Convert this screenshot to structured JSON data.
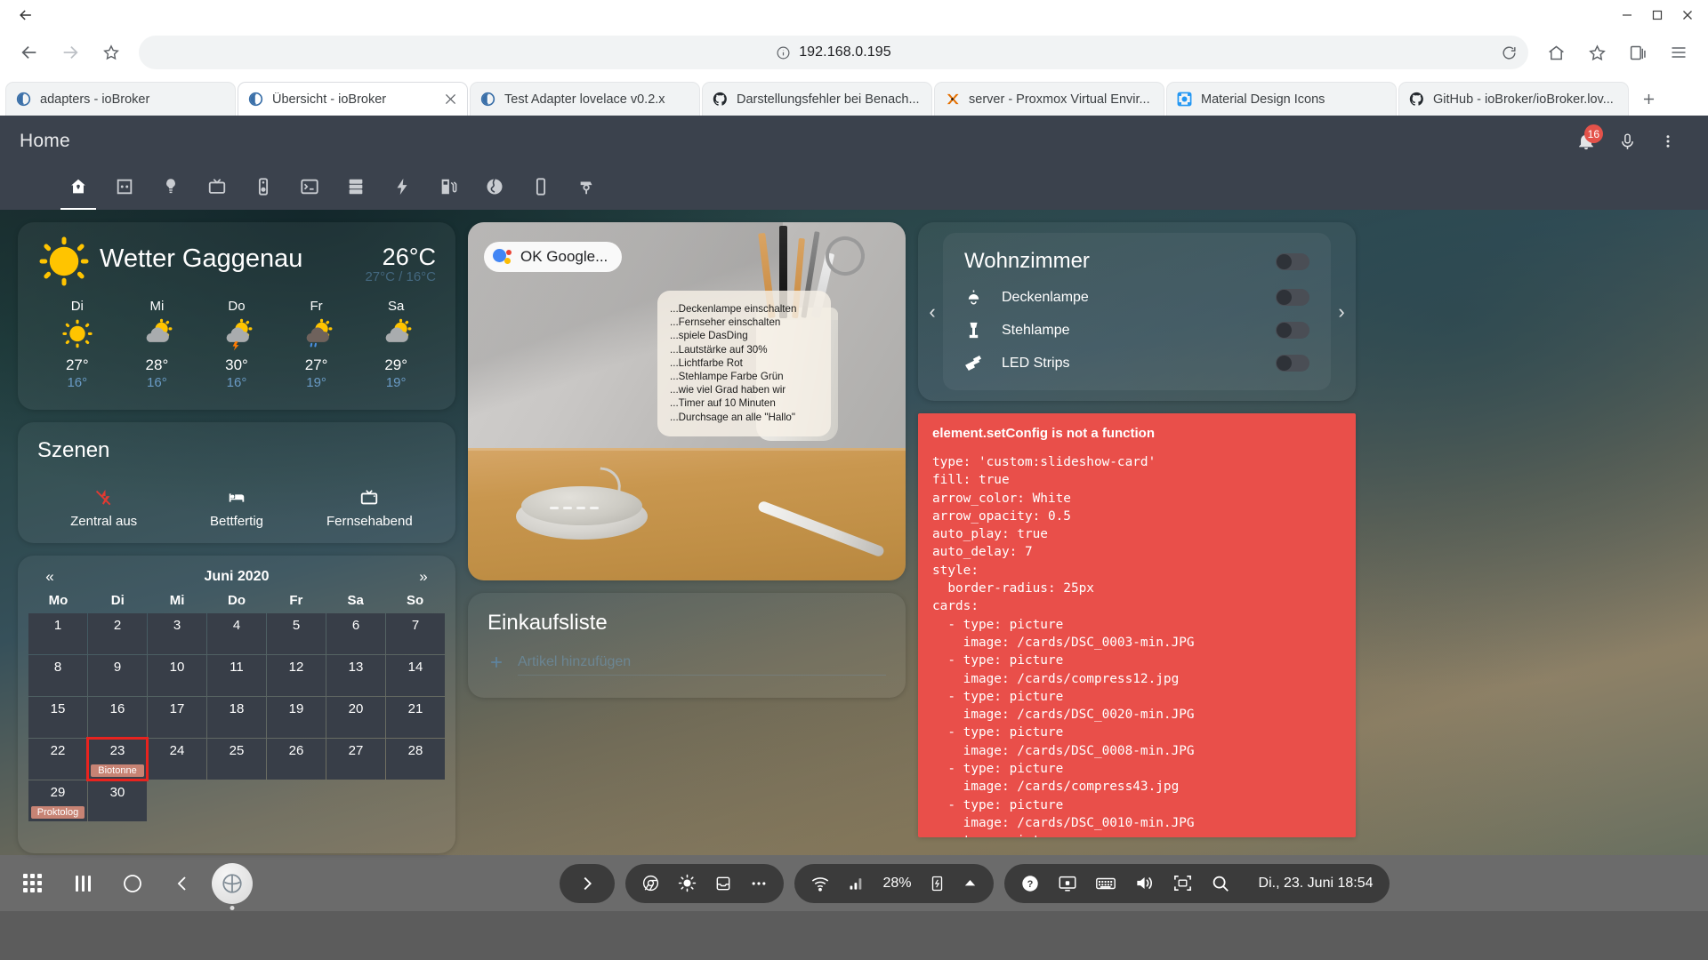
{
  "browser": {
    "url": "192.168.0.195",
    "tabs": [
      {
        "title": "adapters - ioBroker",
        "favicon": "iobroker-icon",
        "active": false,
        "closable": false
      },
      {
        "title": "Übersicht - ioBroker",
        "favicon": "iobroker-icon",
        "active": true,
        "closable": true
      },
      {
        "title": "Test Adapter lovelace v0.2.x",
        "favicon": "iobroker-icon",
        "active": false,
        "closable": false
      },
      {
        "title": "Darstellungsfehler bei Benach...",
        "favicon": "github-icon",
        "active": false,
        "closable": false
      },
      {
        "title": "server - Proxmox Virtual Envir...",
        "favicon": "proxmox-icon",
        "active": false,
        "closable": false
      },
      {
        "title": "Material Design Icons",
        "favicon": "mdi-icon",
        "active": false,
        "closable": false
      },
      {
        "title": "GitHub - ioBroker/ioBroker.lov...",
        "favicon": "github-icon",
        "active": false,
        "closable": false
      }
    ],
    "new_tab_label": "+",
    "window_controls": {
      "minimize": "–",
      "maximize": "□",
      "close": "✕"
    }
  },
  "app": {
    "title": "Home",
    "notification_count": "16",
    "tabs": [
      {
        "icon": "home-icon",
        "selected": true
      },
      {
        "icon": "power-socket-icon",
        "selected": false
      },
      {
        "icon": "lightbulb-icon",
        "selected": false
      },
      {
        "icon": "television-icon",
        "selected": false
      },
      {
        "icon": "speaker-icon",
        "selected": false
      },
      {
        "icon": "console-icon",
        "selected": false
      },
      {
        "icon": "server-icon",
        "selected": false
      },
      {
        "icon": "flash-icon",
        "selected": false
      },
      {
        "icon": "fuel-icon",
        "selected": false
      },
      {
        "icon": "earth-icon",
        "selected": false
      },
      {
        "icon": "cellphone-icon",
        "selected": false
      },
      {
        "icon": "cctv-icon",
        "selected": false
      }
    ]
  },
  "weather": {
    "name": "Wetter Gaggenau",
    "current_temp": "26°C",
    "sub_temp": "27°C / 16°C",
    "current_icon": "sunny-icon",
    "forecast": [
      {
        "day": "Di",
        "icon": "sunny-icon",
        "high": "27°",
        "low": "16°"
      },
      {
        "day": "Mi",
        "icon": "partly-cloudy-icon",
        "high": "28°",
        "low": "16°"
      },
      {
        "day": "Do",
        "icon": "thunderstorm-icon",
        "high": "30°",
        "low": "16°"
      },
      {
        "day": "Fr",
        "icon": "rainy-icon",
        "high": "27°",
        "low": "19°"
      },
      {
        "day": "Sa",
        "icon": "partly-cloudy-icon",
        "high": "29°",
        "low": "19°"
      }
    ]
  },
  "scenes": {
    "title": "Szenen",
    "items": [
      {
        "label": "Zentral aus",
        "icon": "flash-off-icon",
        "color": "#e23a32"
      },
      {
        "label": "Bettfertig",
        "icon": "bed-icon",
        "color": "#ffffff"
      },
      {
        "label": "Fernsehabend",
        "icon": "television-icon",
        "color": "#ffffff"
      }
    ]
  },
  "calendar": {
    "month": "Juni 2020",
    "prev": "«",
    "next": "»",
    "weekdays": [
      "Mo",
      "Di",
      "Mi",
      "Do",
      "Fr",
      "Sa",
      "So"
    ],
    "days": [
      {
        "n": "1"
      },
      {
        "n": "2"
      },
      {
        "n": "3"
      },
      {
        "n": "4"
      },
      {
        "n": "5"
      },
      {
        "n": "6"
      },
      {
        "n": "7"
      },
      {
        "n": "8"
      },
      {
        "n": "9"
      },
      {
        "n": "10"
      },
      {
        "n": "11"
      },
      {
        "n": "12"
      },
      {
        "n": "13"
      },
      {
        "n": "14"
      },
      {
        "n": "15"
      },
      {
        "n": "16"
      },
      {
        "n": "17"
      },
      {
        "n": "18"
      },
      {
        "n": "19"
      },
      {
        "n": "20"
      },
      {
        "n": "21"
      },
      {
        "n": "22"
      },
      {
        "n": "23",
        "today": true,
        "event": "Biotonne"
      },
      {
        "n": "24"
      },
      {
        "n": "25"
      },
      {
        "n": "26"
      },
      {
        "n": "27"
      },
      {
        "n": "28"
      },
      {
        "n": "29",
        "event": "Proktolog"
      },
      {
        "n": "30"
      }
    ]
  },
  "google_card": {
    "badge": "OK Google...",
    "commands": [
      "...Deckenlampe einschalten",
      "...Fernseher einschalten",
      "...spiele DasDing",
      "...Lautstärke auf 30%",
      "...Lichtfarbe Rot",
      "...Stehlampe Farbe Grün",
      "...wie viel Grad haben wir",
      "...Timer auf 10 Minuten",
      "...Durchsage an alle \"Hallo\""
    ]
  },
  "shopping": {
    "title": "Einkaufsliste",
    "input_value": "",
    "input_placeholder": "Artikel hinzufügen",
    "add_icon": "plus-icon"
  },
  "livingroom": {
    "title": "Wohnzimmer",
    "prev_arrow": "‹",
    "next_arrow": "›",
    "master_toggle": "off",
    "rows": [
      {
        "label": "Deckenlampe",
        "icon": "ceiling-light-icon",
        "state": "off"
      },
      {
        "label": "Stehlampe",
        "icon": "floor-lamp-icon",
        "state": "off"
      },
      {
        "label": "LED Strips",
        "icon": "led-strip-icon",
        "state": "off"
      }
    ]
  },
  "error_card": {
    "title": "element.setConfig is not a function",
    "background": "#e94f4a",
    "yaml": "type: 'custom:slideshow-card'\nfill: true\narrow_color: White\narrow_opacity: 0.5\nauto_play: true\nauto_delay: 7\nstyle:\n  border-radius: 25px\ncards:\n  - type: picture\n    image: /cards/DSC_0003-min.JPG\n  - type: picture\n    image: /cards/compress12.jpg\n  - type: picture\n    image: /cards/DSC_0020-min.JPG\n  - type: picture\n    image: /cards/DSC_0008-min.JPG\n  - type: picture\n    image: /cards/compress43.jpg\n  - type: picture\n    image: /cards/DSC_0010-min.JPG\n  - type: picture"
  },
  "taskbar": {
    "battery": "28%",
    "clock": "Di., 23. Juni 18:54",
    "left_icons": [
      "apps-grid-icon",
      "window-list-icon",
      "circle-icon",
      "back-icon"
    ],
    "tray_icons": [
      "chrome-icon",
      "brightness-icon",
      "inbox-icon",
      "overflow-icon"
    ],
    "status_icons": [
      "wifi-icon",
      "signal-icon",
      "battery-charging-icon",
      "chevron-up-icon"
    ],
    "right_icons": [
      "help-icon",
      "display-icon",
      "keyboard-icon",
      "volume-icon",
      "screenshot-icon",
      "search-icon"
    ]
  }
}
